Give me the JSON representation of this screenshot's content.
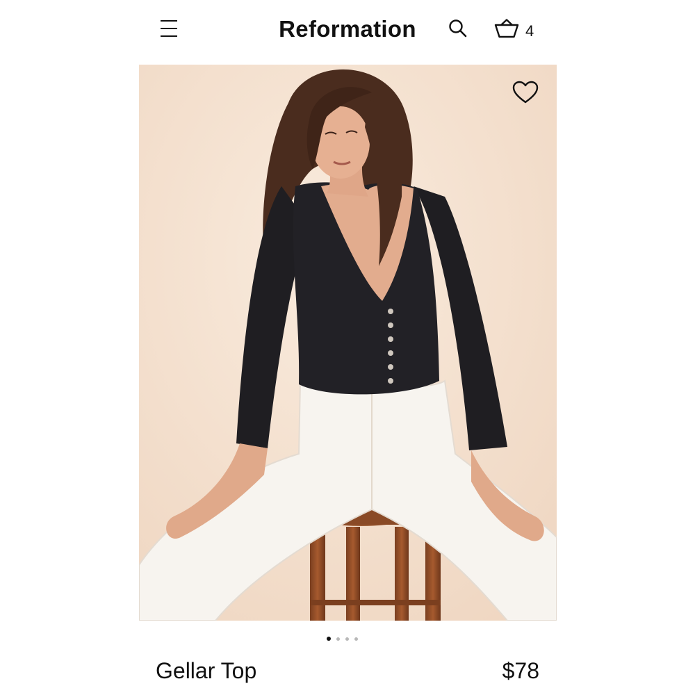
{
  "header": {
    "brand": "Reformation",
    "cart_count": "4",
    "icons": {
      "menu": "hamburger-menu-icon",
      "search": "search-icon",
      "cart": "basket-icon"
    }
  },
  "product": {
    "name": "Gellar Top",
    "price": "$78",
    "wishlist_icon": "heart-outline-icon",
    "image": {
      "description": "model wearing black ribbed button-front top and white jeans seated on wooden stool"
    }
  },
  "carousel": {
    "total": 4,
    "active_index": 0
  },
  "colors": {
    "text": "#111111",
    "background": "#ffffff",
    "image_backdrop": "#f5e2d1",
    "dot_inactive": "#b8b8b8"
  }
}
